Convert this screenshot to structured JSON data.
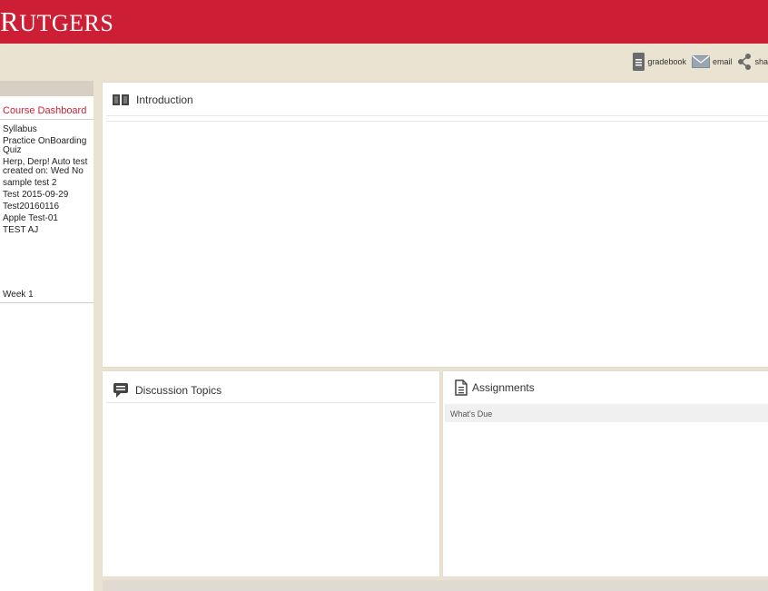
{
  "brand": {
    "first": "R",
    "rest": "UTGERS"
  },
  "colors": {
    "brand_red": "#cc1e34",
    "cream": "#ebe3d2"
  },
  "toolbar": {
    "gradebook": {
      "label": "gradebook",
      "icon": "gradebook-icon"
    },
    "email": {
      "label": "email",
      "icon": "envelope-icon"
    },
    "share": {
      "label": "sha",
      "icon": "share-icon"
    }
  },
  "sidebar": {
    "course_dashboard": "Course Dashboard",
    "items": [
      "Syllabus",
      "Practice OnBoarding Quiz",
      "Herp, Derp! Auto test created on: Wed No",
      "sample test 2",
      "Test 2015-09-29",
      "Test20160116",
      "Apple Test-01",
      "TEST AJ"
    ],
    "week": "Week 1"
  },
  "main": {
    "introduction": {
      "title": "Introduction",
      "icon": "book-icon"
    },
    "discussion": {
      "title": "Discussion Topics",
      "icon": "chat-icon"
    },
    "assignments": {
      "title": "Assignments",
      "icon": "document-icon",
      "subheader": "What's Due"
    }
  }
}
